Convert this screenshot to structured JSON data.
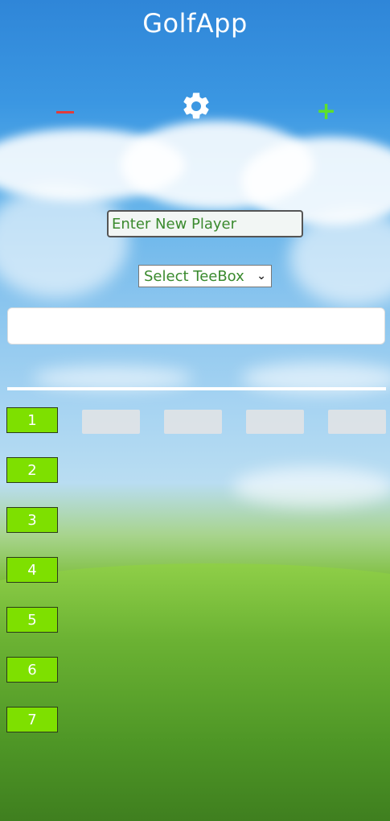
{
  "header": {
    "title": "GolfApp"
  },
  "controls": {
    "remove_icon": "minus-icon",
    "settings_icon": "gear-icon",
    "add_icon": "plus-icon"
  },
  "player_input": {
    "placeholder": "Enter New Player",
    "value": ""
  },
  "teebox_select": {
    "selected": "Select TeeBox"
  },
  "holes": [
    "1",
    "2",
    "3",
    "4",
    "5",
    "6",
    "7"
  ],
  "colors": {
    "hole_bg": "#7ee000",
    "minus": "#e03c3c",
    "plus": "#5de02a",
    "input_text": "#3a8a2e"
  }
}
